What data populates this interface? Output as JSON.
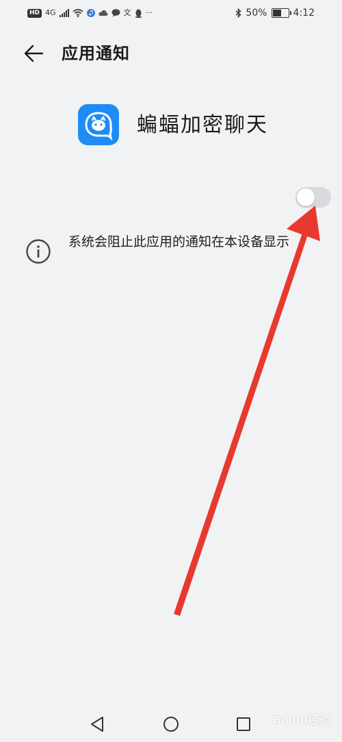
{
  "status_bar": {
    "hd": "HD",
    "network": "4G",
    "text_icon": "文",
    "more": "···",
    "battery_percent": "50%",
    "battery_level": 0.5,
    "time": "4:12"
  },
  "header": {
    "title": "应用通知"
  },
  "app": {
    "name": "蝙蝠加密聊天",
    "icon_color": "#1e8cf5"
  },
  "toggle": {
    "state": "off"
  },
  "info": {
    "text": "系统会阻止此应用的通知在本设备显示"
  },
  "annotation": {
    "arrow_color": "#e8392f"
  },
  "watermark": "Baidu经验"
}
